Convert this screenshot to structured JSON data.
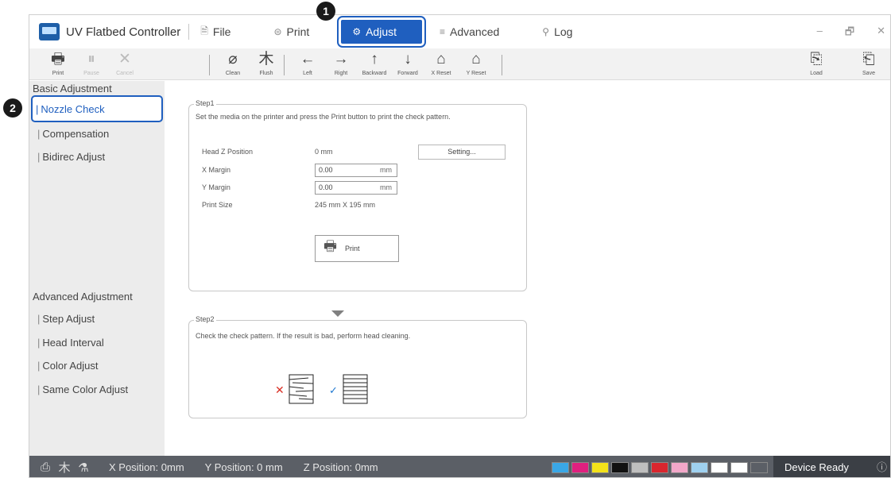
{
  "app": {
    "title": "UV Flatbed Controller"
  },
  "menu": [
    {
      "label": "File",
      "icon": "file-icon",
      "glyph": "🗎"
    },
    {
      "label": "Print",
      "icon": "print-icon",
      "glyph": "⊜"
    },
    {
      "label": "Adjust",
      "icon": "gear-icon",
      "glyph": "⚙"
    },
    {
      "label": "Advanced",
      "icon": "advanced-icon",
      "glyph": "≡"
    },
    {
      "label": "Log",
      "icon": "log-icon",
      "glyph": "⚲"
    }
  ],
  "window_controls": {
    "minimize": "–",
    "restore": "🗗",
    "close": "✕"
  },
  "toolbar": [
    {
      "label": "Print",
      "glyph": "🖶",
      "enabled": true
    },
    {
      "label": "Pause",
      "glyph": "⏸",
      "enabled": false
    },
    {
      "label": "Cancel",
      "glyph": "✕",
      "enabled": false
    },
    {
      "label": "Clean",
      "glyph": "⌀",
      "enabled": true
    },
    {
      "label": "Flush",
      "glyph": "⽊",
      "enabled": true
    },
    {
      "label": "Left",
      "glyph": "←",
      "enabled": true
    },
    {
      "label": "Right",
      "glyph": "→",
      "enabled": true
    },
    {
      "label": "Backward",
      "glyph": "↑",
      "enabled": true
    },
    {
      "label": "Forward",
      "glyph": "↓",
      "enabled": true
    },
    {
      "label": "X Reset",
      "glyph": "⌂",
      "enabled": true
    },
    {
      "label": "Y Reset",
      "glyph": "⌂",
      "enabled": true
    },
    {
      "label": "Load",
      "glyph": "⎘",
      "enabled": true
    },
    {
      "label": "Save",
      "glyph": "⎗",
      "enabled": true
    }
  ],
  "sidebar": {
    "basic_header": "Basic Adjustment",
    "basic_items": [
      "Nozzle Check",
      "Compensation",
      "Bidirec Adjust"
    ],
    "advanced_header": "Advanced Adjustment",
    "advanced_items": [
      "Step Adjust",
      "Head Interval",
      "Color Adjust",
      "Same Color Adjust"
    ],
    "selected": "Nozzle Check"
  },
  "step1": {
    "legend": "Step1",
    "instruction": "Set the media on the printer and press the Print button to print the check pattern.",
    "head_z_label": "Head Z Position",
    "head_z_value": "0 mm",
    "setting_button": "Setting...",
    "x_margin_label": "X Margin",
    "x_margin_value": "0.00",
    "y_margin_label": "Y Margin",
    "y_margin_value": "0.00",
    "unit": "mm",
    "print_size_label": "Print Size",
    "print_size_value": "245 mm X 195 mm",
    "print_button": "Print"
  },
  "step2": {
    "legend": "Step2",
    "instruction": "Check the check pattern. If the result is bad, perform head cleaning."
  },
  "statusbar": {
    "x_position": "X Position: 0mm",
    "y_position": "Y Position: 0 mm",
    "z_position": "Z Position: 0mm",
    "device_status": "Device Ready",
    "ink_colors": [
      "#3aa7e6",
      "#e0207f",
      "#f3e21a",
      "#111111",
      "#bfbfbf",
      "#d9262e",
      "#f2a7c9",
      "#9fd1f0",
      "#ffffff",
      "#ffffff",
      "#5b5f66"
    ]
  },
  "callouts": [
    "1",
    "2"
  ],
  "colors": {
    "accent": "#1f5fbf",
    "statusbar": "#5b5f66"
  }
}
